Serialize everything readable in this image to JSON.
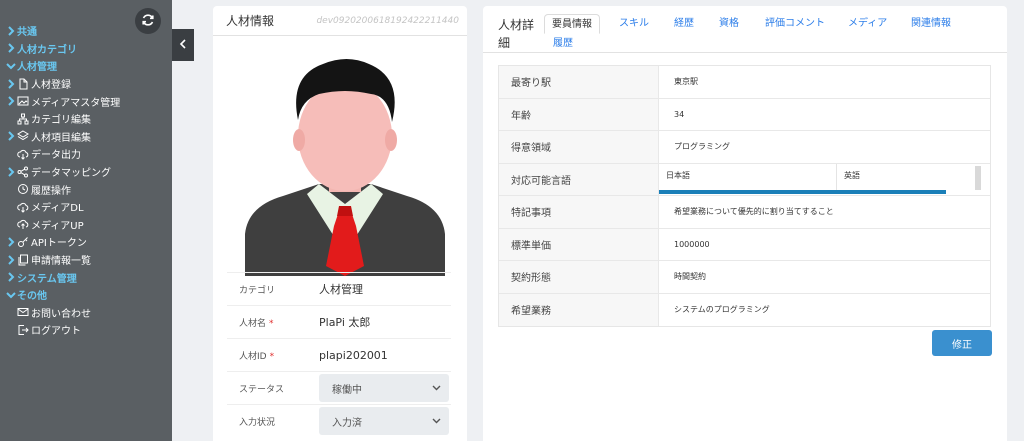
{
  "sidebar": {
    "items": [
      {
        "label": "共通",
        "kind": "top",
        "chevron": "right"
      },
      {
        "label": "人材カテゴリ",
        "kind": "top",
        "chevron": "right"
      },
      {
        "label": "人材管理",
        "kind": "top",
        "chevron": "down"
      },
      {
        "label": "人材登録",
        "kind": "sub",
        "chevron": "right",
        "icon": "file-icon"
      },
      {
        "label": "メディアマスタ管理",
        "kind": "sub",
        "chevron": "right",
        "icon": "image-icon"
      },
      {
        "label": "カテゴリ編集",
        "kind": "sub",
        "chevron": "none",
        "icon": "sitemap-icon"
      },
      {
        "label": "人材項目編集",
        "kind": "sub",
        "chevron": "right",
        "icon": "layers-icon"
      },
      {
        "label": "データ出力",
        "kind": "sub",
        "chevron": "none",
        "icon": "cloud-download-icon"
      },
      {
        "label": "データマッピング",
        "kind": "sub",
        "chevron": "right",
        "icon": "share-icon"
      },
      {
        "label": "履歴操作",
        "kind": "sub",
        "chevron": "none",
        "icon": "clock-icon"
      },
      {
        "label": "メディアDL",
        "kind": "sub",
        "chevron": "none",
        "icon": "cloud-download-icon"
      },
      {
        "label": "メディアUP",
        "kind": "sub",
        "chevron": "none",
        "icon": "cloud-upload-icon"
      },
      {
        "label": "APIトークン",
        "kind": "sub",
        "chevron": "right",
        "icon": "key-icon"
      },
      {
        "label": "申請情報一覧",
        "kind": "sub",
        "chevron": "right",
        "icon": "copy-icon"
      },
      {
        "label": "システム管理",
        "kind": "top",
        "chevron": "right"
      },
      {
        "label": "その他",
        "kind": "top",
        "chevron": "down"
      },
      {
        "label": "お問い合わせ",
        "kind": "sub",
        "chevron": "none",
        "icon": "mail-icon"
      },
      {
        "label": "ログアウト",
        "kind": "sub",
        "chevron": "none",
        "icon": "logout-icon"
      }
    ]
  },
  "left_card": {
    "title": "人材情報",
    "record_id": "dev0920200618192422211440",
    "fields": [
      {
        "label": "カテゴリ",
        "value": "人材管理",
        "required": false,
        "type": "text"
      },
      {
        "label": "人材名",
        "value": "PlaPi 太郎",
        "required": true,
        "type": "text"
      },
      {
        "label": "人材ID",
        "value": "plapi202001",
        "required": true,
        "type": "text"
      },
      {
        "label": "ステータス",
        "value": "稼働中",
        "required": false,
        "type": "select"
      },
      {
        "label": "入力状況",
        "value": "入力済",
        "required": false,
        "type": "select"
      }
    ],
    "required_mark": "*"
  },
  "right_card": {
    "title": "人材詳細",
    "tabs": [
      "要員情報",
      "スキル",
      "経歴",
      "資格",
      "評価コメント",
      "メディア",
      "関連情報",
      "履歴"
    ],
    "active_tab": 0,
    "details": [
      {
        "label": "最寄り駅",
        "value": "東京駅"
      },
      {
        "label": "年齢",
        "value": "34"
      },
      {
        "label": "得意領域",
        "value": "プログラミング"
      },
      {
        "label": "対応可能言語",
        "value": ""
      },
      {
        "label": "特記事項",
        "value": "希望業務について優先的に割り当てすること"
      },
      {
        "label": "標準単価",
        "value": "1000000"
      },
      {
        "label": "契約形態",
        "value": "時間契約"
      },
      {
        "label": "希望業務",
        "value": "システムのプログラミング"
      }
    ],
    "languages": [
      "日本語",
      "英語"
    ],
    "edit_label": "修正"
  },
  "colors": {
    "sidebar_bg": "#5a5f63",
    "sidebar_accent": "#69c7f0",
    "tab_link": "#2b7de9",
    "primary_button": "#3a90cf",
    "required": "#e0302f"
  }
}
